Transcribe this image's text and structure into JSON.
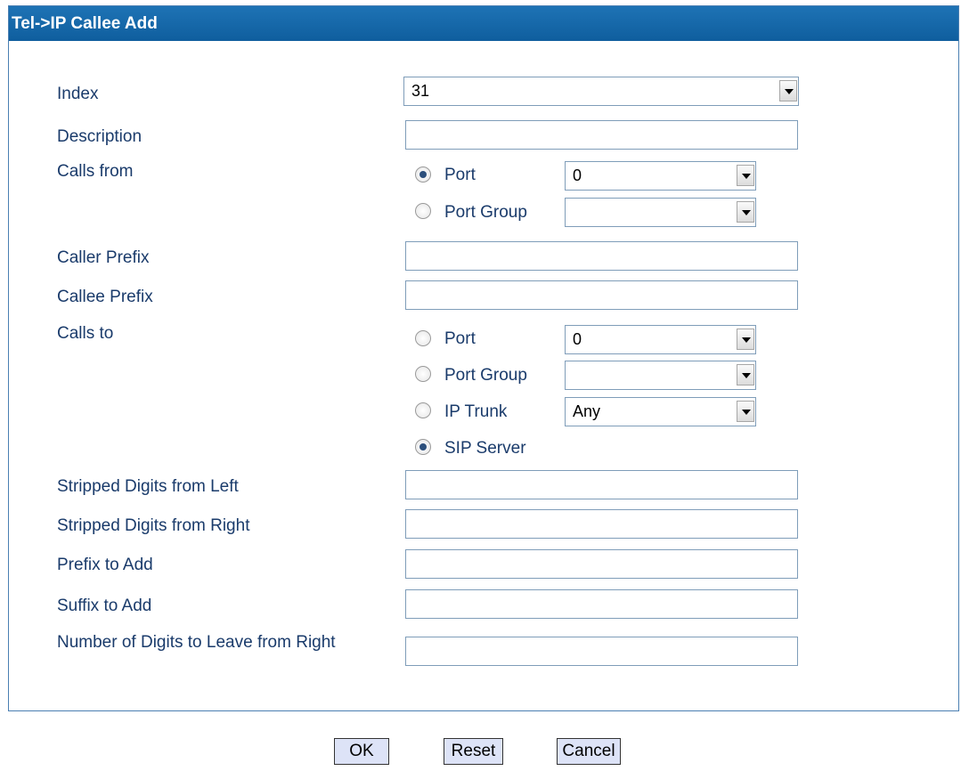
{
  "panel": {
    "title": "Tel->IP Callee Add"
  },
  "fields": {
    "index": {
      "label": "Index",
      "value": "31"
    },
    "description": {
      "label": "Description",
      "value": ""
    },
    "calls_from": {
      "label": "Calls from",
      "port_label": "Port",
      "port_value": "0",
      "port_checked": true,
      "port_group_label": "Port Group",
      "port_group_value": "",
      "port_group_checked": false
    },
    "caller_prefix": {
      "label": "Caller Prefix",
      "value": ""
    },
    "callee_prefix": {
      "label": "Callee Prefix",
      "value": ""
    },
    "calls_to": {
      "label": "Calls to",
      "port_label": "Port",
      "port_value": "0",
      "port_checked": false,
      "port_group_label": "Port Group",
      "port_group_value": "",
      "port_group_checked": false,
      "ip_trunk_label": "IP Trunk",
      "ip_trunk_value": "Any",
      "ip_trunk_checked": false,
      "sip_server_label": "SIP Server",
      "sip_server_checked": true
    },
    "stripped_left": {
      "label": "Stripped Digits from Left",
      "value": ""
    },
    "stripped_right": {
      "label": "Stripped Digits from Right",
      "value": ""
    },
    "prefix_add": {
      "label": "Prefix to Add",
      "value": ""
    },
    "suffix_add": {
      "label": "Suffix to Add",
      "value": ""
    },
    "digits_leave": {
      "label": "Number of Digits to Leave from Right",
      "value": ""
    }
  },
  "buttons": {
    "ok": "OK",
    "reset": "Reset",
    "cancel": "Cancel"
  },
  "colors": {
    "title_bar": "#1565a8",
    "label_text": "#1a3b6b",
    "button_bg": "#dde3f7"
  }
}
